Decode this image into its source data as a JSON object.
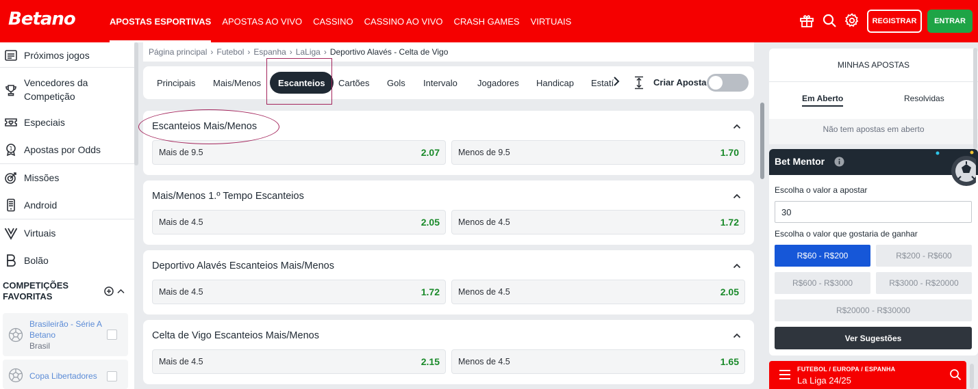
{
  "brand": {
    "logo": "Betano"
  },
  "nav": {
    "items": [
      "APOSTAS ESPORTIVAS",
      "APOSTAS AO VIVO",
      "CASSINO",
      "CASSINO AO VIVO",
      "CRASH GAMES",
      "VIRTUAIS"
    ],
    "register": "REGISTRAR",
    "login": "ENTRAR",
    "icons": [
      "gift-icon",
      "search-icon",
      "gear-icon"
    ]
  },
  "sidebar": {
    "items": [
      {
        "label": "Próximos jogos",
        "icon": "calendar-list-icon"
      },
      {
        "label": "Vencedores da Competição",
        "icon": "trophy-icon"
      },
      {
        "label": "Especiais",
        "icon": "ticket-heart-icon"
      },
      {
        "label": "Apostas por Odds",
        "icon": "odds-badge-icon"
      },
      {
        "label": "Missões",
        "icon": "target-icon"
      },
      {
        "label": "Android",
        "icon": "phone-icon"
      },
      {
        "label": "Virtuais",
        "icon": "virtual-v-icon"
      },
      {
        "label": "Bolão",
        "icon": "bolao-icon"
      }
    ],
    "favorites": {
      "title": "COMPETIÇÕES FAVORITAS",
      "items": [
        {
          "name": "Brasileirão - Série A Betano",
          "country": "Brasil"
        },
        {
          "name": "Copa Libertadores",
          "country": ""
        }
      ]
    }
  },
  "breadcrumb": [
    "Página principal",
    "Futebol",
    "Espanha",
    "LaLiga",
    "Deportivo Alavés - Celta de Vigo"
  ],
  "tabs": {
    "items": [
      "Principais",
      "Mais/Menos",
      "Escanteios",
      "Cartões",
      "Gols",
      "Intervalo",
      "Jogadores",
      "Handicap",
      "Estatí"
    ],
    "active": "Escanteios",
    "create_bet": "Criar Aposta"
  },
  "markets": [
    {
      "title": "Escanteios Mais/Menos",
      "left": {
        "label": "Mais de 9.5",
        "odd": "2.07"
      },
      "right": {
        "label": "Menos de 9.5",
        "odd": "1.70"
      }
    },
    {
      "title": "Mais/Menos 1.º Tempo Escanteios",
      "left": {
        "label": "Mais de 4.5",
        "odd": "2.05"
      },
      "right": {
        "label": "Menos de 4.5",
        "odd": "1.72"
      }
    },
    {
      "title": "Deportivo Alavés Escanteios Mais/Menos",
      "left": {
        "label": "Mais de 4.5",
        "odd": "1.72"
      },
      "right": {
        "label": "Menos de 4.5",
        "odd": "2.05"
      }
    },
    {
      "title": "Celta de Vigo Escanteios Mais/Menos",
      "left": {
        "label": "Mais de 4.5",
        "odd": "2.15"
      },
      "right": {
        "label": "Menos de 4.5",
        "odd": "1.65"
      }
    }
  ],
  "my_bets": {
    "title": "MINHAS APOSTAS",
    "tabs": [
      "Em Aberto",
      "Resolvidas"
    ],
    "empty": "Não tem apostas em aberto"
  },
  "bet_mentor": {
    "title": "Bet Mentor",
    "stake_label": "Escolha o valor a apostar",
    "stake_value": "30",
    "win_label": "Escolha o valor que gostaria de ganhar",
    "ranges": [
      "R$60 - R$200",
      "R$200 - R$600",
      "R$600 - R$3000",
      "R$3000 - R$20000",
      "R$20000 - R$30000"
    ],
    "active_range": "R$60 - R$200",
    "button": "Ver Sugestões"
  },
  "context_bar": {
    "path": "FUTEBOL / EUROPA / ESPANHA",
    "title": "La Liga 24/25"
  },
  "colors": {
    "brand_red": "#f50000",
    "odd_green": "#1a8a2a",
    "register_green": "#1ea446",
    "active_blue": "#1657d8",
    "annotation": "#a3245b"
  }
}
